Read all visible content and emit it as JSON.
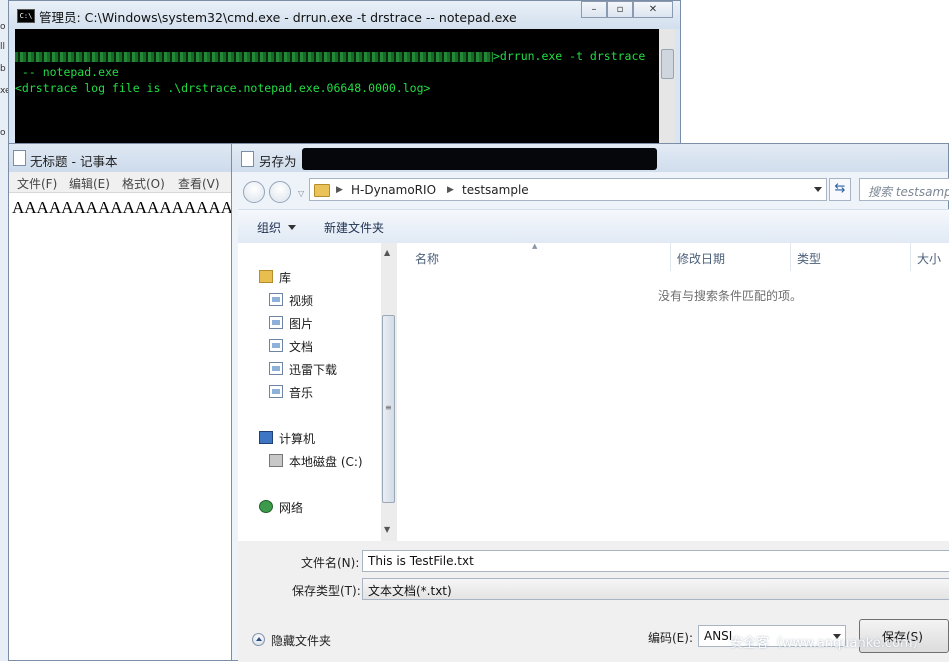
{
  "desktop": {
    "edge_chars": [
      "o",
      "ll",
      "b",
      "xe",
      "o"
    ]
  },
  "cmd": {
    "title": "管理员: C:\\Windows\\system32\\cmd.exe - drrun.exe  -t drstrace -- notepad.exe",
    "icon_text": "C:\\",
    "line1_tail": ">drrun.exe -t drstrace",
    "line2": " -- notepad.exe",
    "line3": "<drstrace log file is .\\drstrace.notepad.exe.06648.0000.log>",
    "text_color": "#22dd44",
    "bg_color": "#000000"
  },
  "notepad": {
    "title": "无标题 - 记事本",
    "menu": [
      "文件(F)",
      "编辑(E)",
      "格式(O)",
      "查看(V)"
    ],
    "text": "AAAAAAAAAAAAAAAAAA"
  },
  "dialog": {
    "title": "另存为",
    "address": [
      "H-DynamoRIO",
      "testsample"
    ],
    "search_placeholder": "搜索 testsample",
    "toolbar": {
      "organize": "组织",
      "new_folder": "新建文件夹"
    },
    "nav": {
      "libraries": "库",
      "videos": "视频",
      "pictures": "图片",
      "documents": "文档",
      "thunder": "迅雷下载",
      "music": "音乐",
      "computer": "计算机",
      "local_disk": "本地磁盘 (C:)",
      "network": "网络"
    },
    "columns": [
      "名称",
      "修改日期",
      "类型",
      "大小"
    ],
    "empty_message": "没有与搜索条件匹配的项。",
    "filename_label": "文件名(N):",
    "filename_value": "This is TestFile.txt",
    "filetype_label": "保存类型(T):",
    "filetype_value": "文本文档(*.txt)",
    "hide_folders": "隐藏文件夹",
    "encoding_label": "编码(E):",
    "encoding_value": "ANSI",
    "save_button": "保存(S)"
  },
  "watermark": "安全客（www.anquanke.com）"
}
